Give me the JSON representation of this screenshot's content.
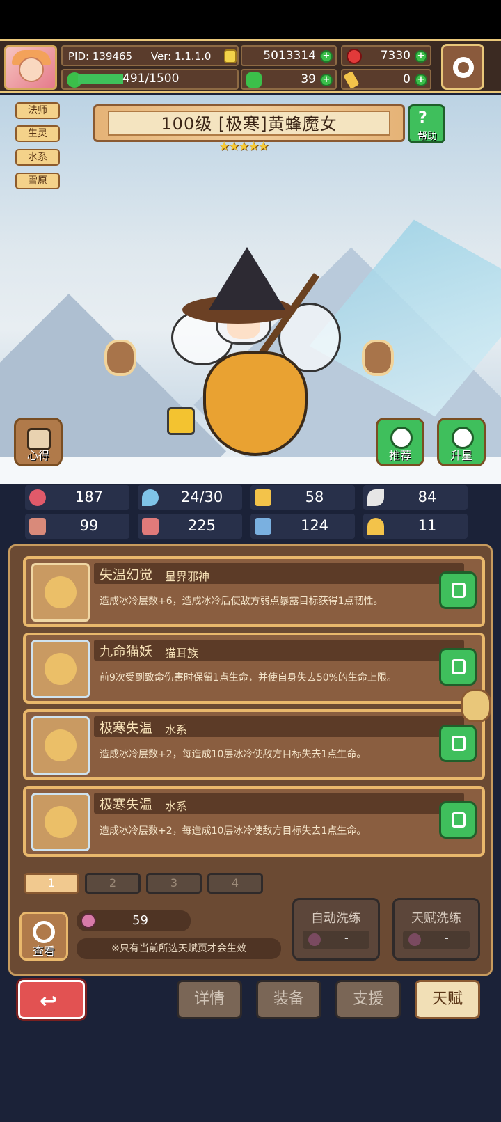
{
  "header": {
    "pid_label": "PID: 139465",
    "version_label": "Ver: 1.1.1.0",
    "gold": "5013314",
    "gems": "7330",
    "exp": "491/1500",
    "exp_fraction": 0.327,
    "clover": "39",
    "keys": "0"
  },
  "tags": [
    "法师",
    "生灵",
    "水系",
    "雪原"
  ],
  "hero": {
    "title": "100级  [极寒]黄蜂魔女",
    "stars": "★★★★★",
    "help_label": "帮助"
  },
  "side_buttons": {
    "tips": "心得",
    "recommend": "推荐",
    "star_up": "升星"
  },
  "stats": [
    {
      "icon": "heart-icon",
      "value": "187",
      "color": "#e05a6a"
    },
    {
      "icon": "water-drop-icon",
      "value": "24/30",
      "color": "#7fc4e8"
    },
    {
      "icon": "shield-icon",
      "value": "58",
      "color": "#f3c34a"
    },
    {
      "icon": "wing-icon",
      "value": "84",
      "color": "#e6e6e6"
    },
    {
      "icon": "fist-icon",
      "value": "99",
      "color": "#d98a7a"
    },
    {
      "icon": "book-icon",
      "value": "225",
      "color": "#e07a7a"
    },
    {
      "icon": "boot-icon",
      "value": "124",
      "color": "#7ab0e0"
    },
    {
      "icon": "horseshoe-icon",
      "value": "11",
      "color": "#f3c34a"
    }
  ],
  "talents": [
    {
      "name": "失温幻觉",
      "sub": "星界邪神",
      "desc": "造成冰冷层数+6，造成冰冷后使敌方弱点暴露目标获得1点韧性。"
    },
    {
      "name": "九命猫妖",
      "sub": "猫耳族",
      "desc": "前9次受到致命伤害时保留1点生命，并使自身失去50%的生命上限。"
    },
    {
      "name": "极寒失温",
      "sub": "水系",
      "desc": "造成冰冷层数+2，每造成10层冰冷使敌方目标失去1点生命。"
    },
    {
      "name": "极寒失温",
      "sub": "水系",
      "desc": "造成冰冷层数+2，每造成10层冰冷使敌方目标失去1点生命。"
    }
  ],
  "pages": [
    "1",
    "2",
    "3",
    "4"
  ],
  "bottom": {
    "search_label": "查看",
    "potion_count": "59",
    "note": "※只有当前所选天赋页才会生效",
    "auto_reroll": "自动洗练",
    "talent_reroll": "天赋洗练",
    "reroll_cost": "-"
  },
  "nav": [
    "详情",
    "装备",
    "支援",
    "天赋"
  ],
  "colors": {
    "accent_green": "#3fbf5c",
    "gold_border": "#e9b86c",
    "active_tab": "#f1dfb6"
  }
}
